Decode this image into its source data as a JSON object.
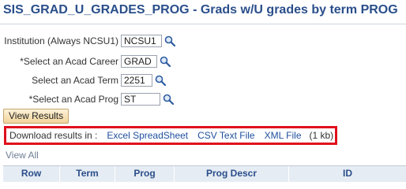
{
  "page": {
    "title": "SIS_GRAD_U_GRADES_PROG - Grads w/U grades by term PROG"
  },
  "form": {
    "fields": [
      {
        "label": "Institution (Always NCSU1)",
        "value": "NCSU1"
      },
      {
        "label": "*Select an Acad Career",
        "value": "GRAD"
      },
      {
        "label": "Select an Acad Term",
        "value": "2251"
      },
      {
        "label": "*Select an Acad Prog",
        "value": "ST"
      }
    ],
    "lookup_icon": "magnifier-lookup-icon",
    "view_results_label": "View Results"
  },
  "download": {
    "prefix": "Download results in :",
    "excel_label": "Excel SpreadSheet",
    "csv_label": "CSV Text File",
    "xml_label": "XML File",
    "size_text": "(1 kb)",
    "highlight_color": "#e0101c"
  },
  "grid": {
    "view_all_label": "View All",
    "columns": [
      "Row",
      "Term",
      "Prog",
      "Prog Descr",
      "ID"
    ]
  },
  "colors": {
    "title": "#2a4e8a",
    "link": "#1f4f9e",
    "header_bg": "#e6ecf3"
  }
}
